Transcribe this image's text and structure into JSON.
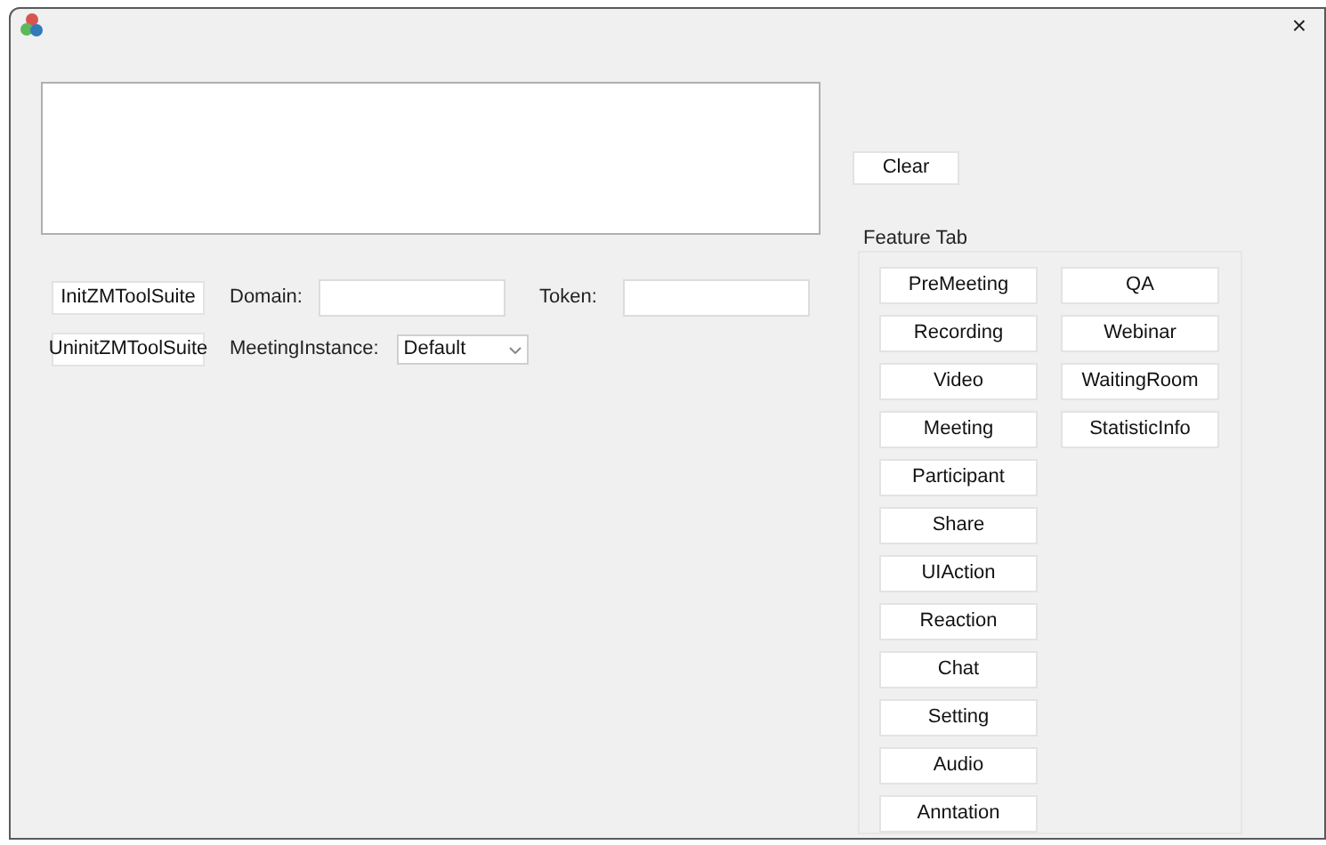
{
  "window": {
    "close": "×"
  },
  "clear_button": "Clear",
  "init_button": "InitZMToolSuite",
  "uninit_button": "UninitZMToolSuite",
  "domain": {
    "label": "Domain:"
  },
  "token": {
    "label": "Token:"
  },
  "meeting_instance": {
    "label": "MeetingInstance:",
    "value": "Default"
  },
  "feature_tab": {
    "title": "Feature Tab",
    "columns": [
      [
        "PreMeeting",
        "Recording",
        "Video",
        "Meeting",
        "Participant",
        "Share",
        "UIAction",
        "Reaction",
        "Chat",
        "Setting",
        "Audio",
        "Anntation"
      ],
      [
        "QA",
        "Webinar",
        "WaitingRoom",
        "StatisticInfo"
      ]
    ]
  }
}
